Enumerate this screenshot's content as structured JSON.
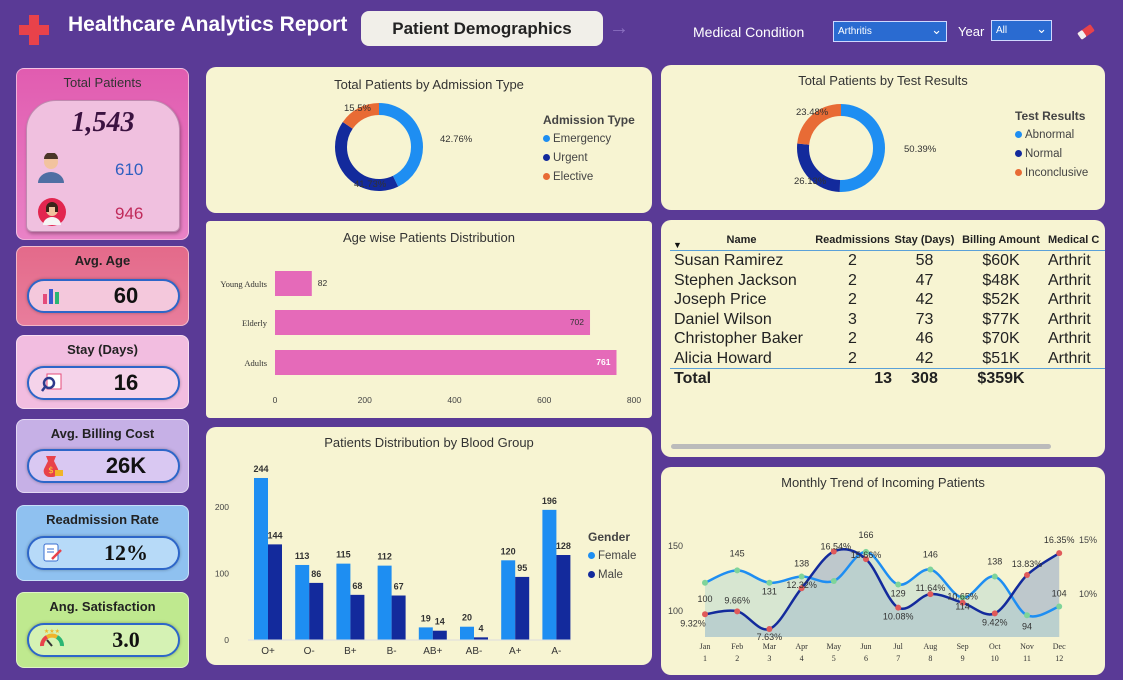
{
  "header": {
    "title": "Healthcare Analytics Report",
    "page_button": "Patient Demographics",
    "condition_label": "Medical Condition",
    "condition_value": "Arthritis",
    "year_label": "Year",
    "year_value": "All"
  },
  "kpis": {
    "total_patients_title": "Total Patients",
    "total_patients": "1,543",
    "male_count": "610",
    "female_count": "946",
    "avg_age_title": "Avg. Age",
    "avg_age": "60",
    "stay_title": "Stay (Days)",
    "stay": "16",
    "billing_title": "Avg. Billing Cost",
    "billing": "26K",
    "readmission_title": "Readmission Rate",
    "readmission": "12%",
    "satisfaction_title": "Ang. Satisfaction",
    "satisfaction": "3.0"
  },
  "colors": {
    "emergency": "#1e8ef2",
    "urgent": "#132a9c",
    "elective": "#e86b35",
    "pink_bar": "#e56ab9",
    "female": "#1e8ef2",
    "male": "#132a9c"
  },
  "admission_chart": {
    "title": "Total Patients by Admission Type",
    "legend_title": "Admission Type",
    "legend": [
      "Emergency",
      "Urgent",
      "Elective"
    ],
    "chart_data": {
      "type": "pie",
      "categories": [
        "Emergency",
        "Urgent",
        "Elective"
      ],
      "values": [
        42.76,
        41.73,
        15.5
      ],
      "labels": [
        "42.76%",
        "41.73%",
        "15.5%"
      ]
    }
  },
  "test_chart": {
    "title": "Total Patients by Test Results",
    "legend_title": "Test Results",
    "legend": [
      "Abnormal",
      "Normal",
      "Inconclusive"
    ],
    "chart_data": {
      "type": "pie",
      "categories": [
        "Abnormal",
        "Normal",
        "Inconclusive"
      ],
      "values": [
        50.39,
        26.13,
        23.48
      ],
      "labels": [
        "50.39%",
        "26.13%",
        "23.48%"
      ]
    }
  },
  "age_chart": {
    "title": "Age wise Patients Distribution",
    "chart_data": {
      "type": "bar",
      "orientation": "horizontal",
      "categories": [
        "Young Adults",
        "Elderly",
        "Adults"
      ],
      "values": [
        82,
        702,
        761
      ],
      "xlim": [
        0,
        800
      ],
      "xticks": [
        "0",
        "200",
        "400",
        "600",
        "800"
      ]
    }
  },
  "blood_chart": {
    "title": "Patients Distribution by Blood Group",
    "legend_title": "Gender",
    "legend": [
      "Female",
      "Male"
    ],
    "chart_data": {
      "type": "bar",
      "categories": [
        "O+",
        "O-",
        "B+",
        "B-",
        "AB+",
        "AB-",
        "A+",
        "A-"
      ],
      "series": [
        {
          "name": "Female",
          "values": [
            244,
            113,
            115,
            112,
            19,
            20,
            120,
            196
          ]
        },
        {
          "name": "Male",
          "values": [
            144,
            86,
            68,
            67,
            14,
            4,
            95,
            128
          ]
        }
      ],
      "ylim": [
        0,
        250
      ],
      "yticks": [
        "0",
        "100",
        "200"
      ]
    }
  },
  "table": {
    "columns": [
      "Name",
      "Readmissions",
      "Stay (Days)",
      "Billing Amount",
      "Medical C"
    ],
    "rows": [
      [
        "Susan Ramirez",
        "2",
        "58",
        "$60K",
        "Arthrit"
      ],
      [
        "Stephen Jackson",
        "2",
        "47",
        "$48K",
        "Arthrit"
      ],
      [
        "Joseph Price",
        "2",
        "42",
        "$52K",
        "Arthrit"
      ],
      [
        "Daniel Wilson",
        "3",
        "73",
        "$77K",
        "Arthrit"
      ],
      [
        "Christopher Baker",
        "2",
        "46",
        "$70K",
        "Arthrit"
      ],
      [
        "Alicia Howard",
        "2",
        "42",
        "$51K",
        "Arthrit"
      ]
    ],
    "total": [
      "Total",
      "13",
      "308",
      "$359K",
      ""
    ]
  },
  "monthly_chart": {
    "title": "Monthly Trend of Incoming Patients",
    "chart_data": {
      "type": "line",
      "x": [
        "Jan",
        "Feb",
        "Mar",
        "Apr",
        "May",
        "Jun",
        "Jul",
        "Aug",
        "Sep",
        "Oct",
        "Nov",
        "Dec"
      ],
      "x_sub": [
        "1",
        "2",
        "3",
        "4",
        "5",
        "6",
        "7",
        "8",
        "9",
        "10",
        "11",
        "12"
      ],
      "series": [
        {
          "values": [
            131,
            145,
            131,
            138,
            133,
            166,
            129,
            146,
            114,
            138,
            94,
            104
          ],
          "labels": [
            "",
            "145",
            "131",
            "138",
            "",
            "166",
            "129",
            "146",
            "114",
            "138",
            "94",
            "104"
          ]
        },
        {
          "values": [
            9.32,
            9.66,
            7.63,
            12.32,
            16.54,
            15.66,
            10.08,
            11.64,
            10.65,
            9.42,
            13.83,
            16.35
          ],
          "labels": [
            "9.32%",
            "9.66%",
            "7.63%",
            "12.32%",
            "16.54%",
            "15.66%",
            "10.08%",
            "11.64%",
            "10.65%",
            "9.42%",
            "13.83%",
            "16.35%"
          ]
        }
      ],
      "extra_label": "100",
      "y_left_ticks": [
        "150",
        "100"
      ],
      "y_right_ticks": [
        "15%",
        "10%"
      ]
    }
  }
}
